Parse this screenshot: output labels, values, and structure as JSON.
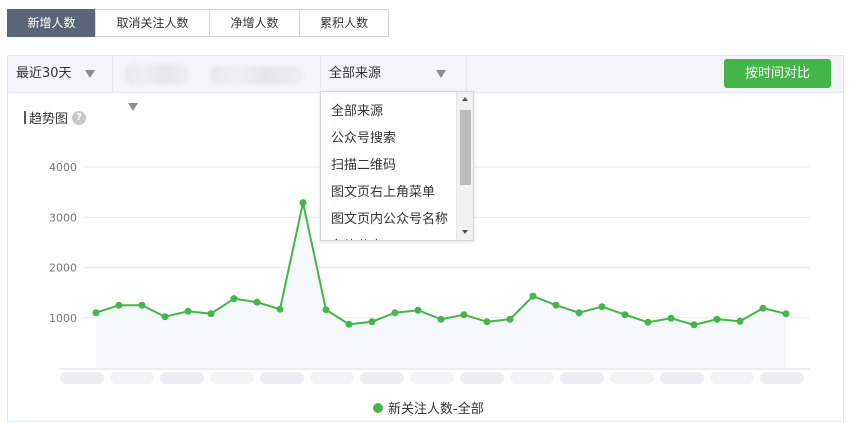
{
  "tabs": [
    {
      "label": "新增人数",
      "active": true
    },
    {
      "label": "取消关注人数",
      "active": false
    },
    {
      "label": "净增人数",
      "active": false
    },
    {
      "label": "累积人数",
      "active": false
    }
  ],
  "toolbar": {
    "date_range": "最近30天",
    "source_select": "全部来源",
    "compare_button": "按时间对比"
  },
  "dropdown": {
    "options": [
      "全部来源",
      "公众号搜索",
      "扫描二维码",
      "图文页右上角菜单",
      "图文页内公众号名称",
      "名片分享"
    ]
  },
  "section": {
    "title": "趋势图",
    "help": "?"
  },
  "colors": {
    "accent": "#44b549",
    "active_tab": "#5b6578"
  },
  "chart_data": {
    "type": "line",
    "title": "",
    "xlabel": "",
    "ylabel": "",
    "ylim": [
      0,
      4000
    ],
    "yticks": [
      "1000",
      "2000",
      "3000",
      "4000"
    ],
    "grid": true,
    "legend_position": "bottom",
    "series": [
      {
        "name": "新关注人数-全部",
        "values": [
          1100,
          1250,
          1250,
          1020,
          1130,
          1080,
          1380,
          1310,
          1170,
          3290,
          1160,
          870,
          920,
          1100,
          1150,
          970,
          1060,
          920,
          970,
          1430,
          1250,
          1100,
          1220,
          1060,
          910,
          990,
          860,
          970,
          930,
          1190,
          1080
        ]
      }
    ]
  }
}
